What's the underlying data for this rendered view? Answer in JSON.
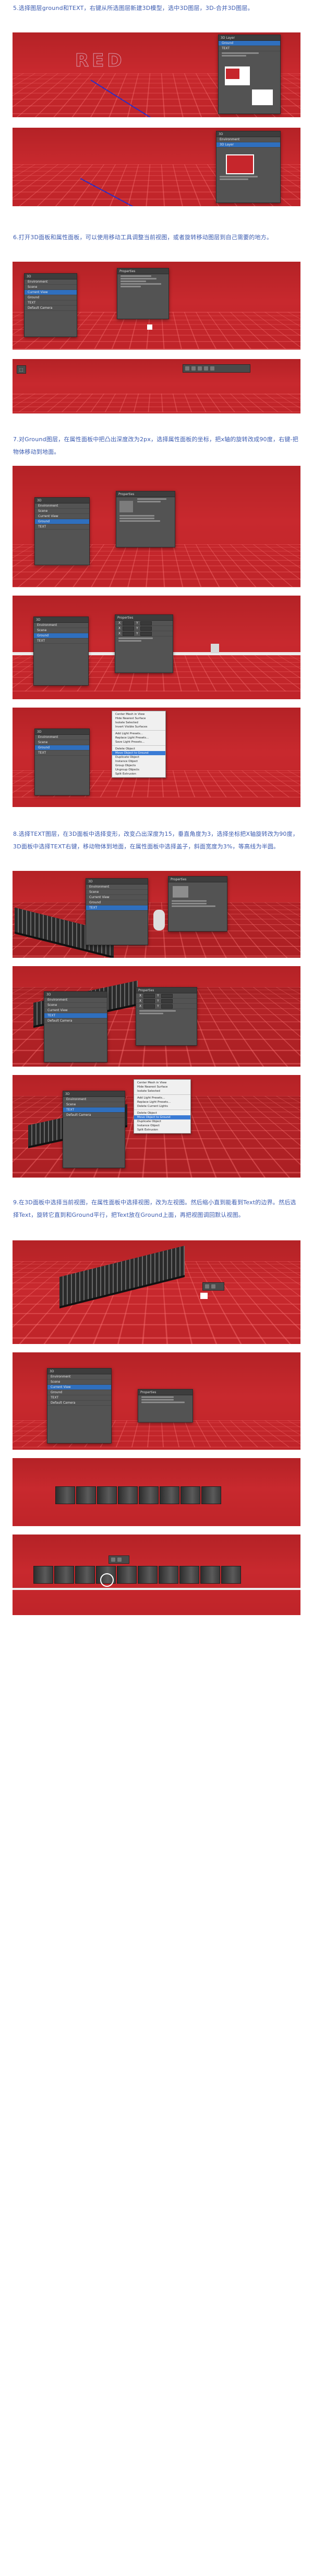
{
  "steps": [
    {
      "text": "5.选择图层ground和TEXT，右键从所选图层新建3D模型，选中3D图层，3D-合并3D图层。",
      "screens": [
        "shot-5a",
        "shot-5b"
      ]
    },
    {
      "text": "6.打开3D面板和属性面板，可以使用移动工具调整当前视图，或者旋转移动图层到自己需要的地方。",
      "screens": [
        "shot-6a",
        "shot-6b"
      ]
    },
    {
      "text": "7.对Ground图层，在属性面板中把凸出深度改为2px，选择属性面板的坐标，把x轴的旋转改成90度，右键-把物体移动到地面。",
      "screens": [
        "shot-7a",
        "shot-7b",
        "shot-7c"
      ]
    },
    {
      "text": "8.选择TEXT图层，在3D面板中选择变形，改变凸出深度为15，垂直角度为3，选择坐标把X轴旋转改为90度，3D面板中选择TEXT右键，移动物体到地面，在属性面板中选择盖子，斜面宽度为3%，等高线为半圆。",
      "screens": [
        "shot-8a",
        "shot-8b",
        "shot-8c"
      ]
    },
    {
      "text": "9.在3D面板中选择当前视图，在属性面板中选择视图，改为左视图。然后缩小直到能看到Text的边界。然后选择Text，旋转它直到和Ground平行，把Text放在Ground上面，再把视图调回默认视图。",
      "screens": [
        "shot-9a",
        "shot-9b",
        "shot-9c",
        "shot-9d"
      ]
    }
  ],
  "panels": {
    "layers_tab": "3D",
    "properties_tab": "Properties",
    "merge_label": "3D Layer",
    "row_labels": [
      "Environment",
      "Scene",
      "Current View",
      "Ground",
      "TEXT",
      "Default Camera"
    ],
    "toolbar_icon": "3d-tool-icon"
  },
  "context_menu": {
    "items": [
      "Center Mesh in View",
      "Hide Nearest Surface",
      "Isolate Selected",
      "Invert Visible Surfaces",
      "Reveal All Surfaces",
      "Add Light Presets...",
      "Replace Light Presets...",
      "Save Light Presets...",
      "Delete Current Lights",
      "Delete Object",
      "Move Object to Ground",
      "Duplicate Object",
      "Instance Object",
      "Group Objects",
      "Ungroup Objects",
      "Split Extrusion"
    ],
    "highlight_index": 10
  },
  "colors": {
    "scene_red": "#c6262c",
    "panel_gray": "#535353",
    "text_blue": "#3b5bb0",
    "axis_blue": "#2a2fc7",
    "selection_blue": "#2f6fbe"
  }
}
